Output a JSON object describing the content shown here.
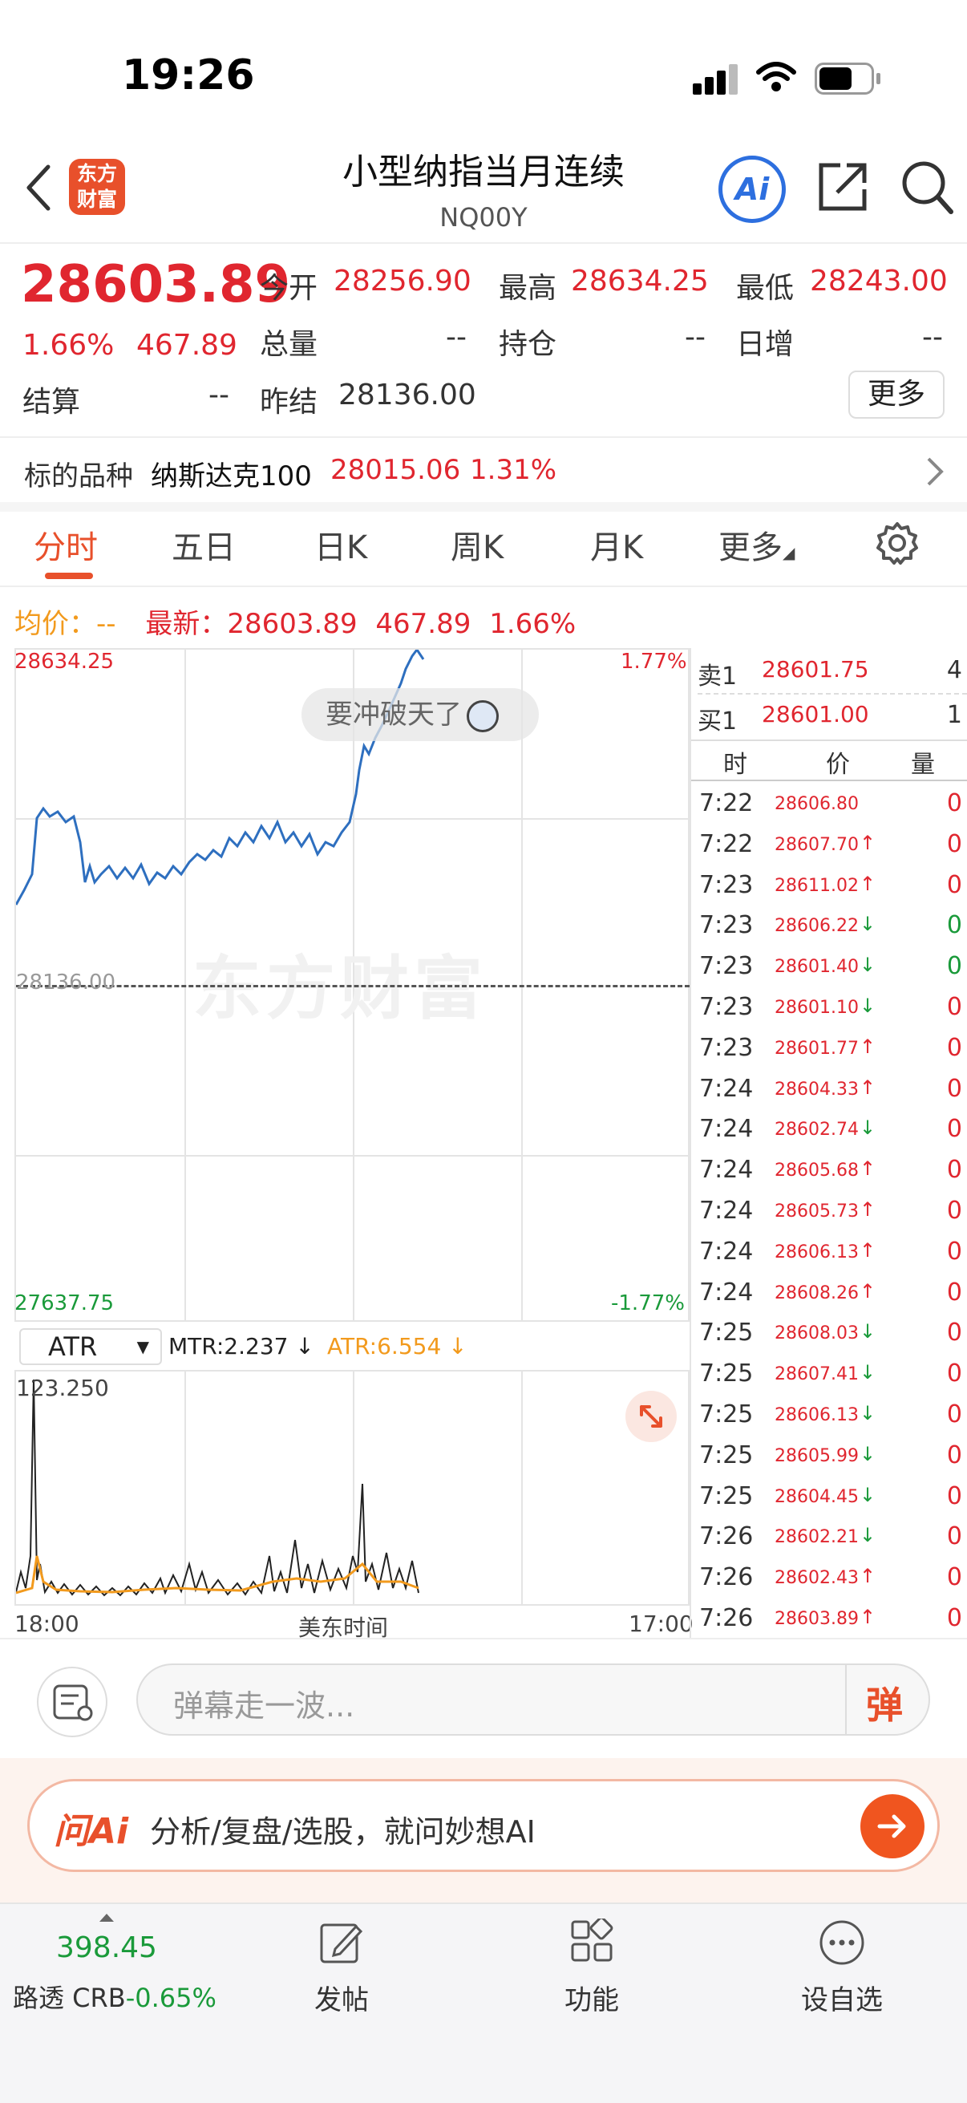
{
  "status_bar": {
    "time": "19:26"
  },
  "header": {
    "title": "小型纳指当月连续",
    "code": "NQ00Y",
    "logo_line1": "东方",
    "logo_line2": "财富",
    "ai_label": "Ai"
  },
  "quote": {
    "price": "28603.89",
    "change_pct": "1.66%",
    "change": "467.89",
    "open_label": "今开",
    "open": "28256.90",
    "high_label": "最高",
    "high": "28634.25",
    "low_label": "最低",
    "low": "28243.00",
    "volume_label": "总量",
    "volume": "--",
    "position_label": "持仓",
    "position": "--",
    "daily_inc_label": "日增",
    "daily_inc": "--",
    "settle_label": "结算",
    "settle": "--",
    "prev_settle_label": "昨结",
    "prev_settle": "28136.00",
    "more_label": "更多"
  },
  "underlying": {
    "label": "标的品种",
    "name": "纳斯达克100",
    "price": "28015.06",
    "pct": "1.31%"
  },
  "tabs": [
    "分时",
    "五日",
    "日K",
    "周K",
    "月K",
    "更多"
  ],
  "chart": {
    "avg_label": "均价：",
    "avg_value": "--",
    "latest_label": "最新：",
    "latest": "28603.89",
    "latest_change": "467.89",
    "latest_pct": "1.66%",
    "y_max": "28634.25",
    "y_min": "27637.75",
    "pct_max": "1.77%",
    "pct_min": "-1.77%",
    "base_label": "28136.00",
    "bubble_text": "要冲破天了",
    "watermark": "东方财富",
    "x_start": "18:00",
    "x_mid": "美东时间",
    "x_end": "17:00"
  },
  "indicator": {
    "name": "ATR",
    "mtr": "MTR:2.237 ↓",
    "atr": "ATR:6.554 ↓",
    "y_max": "123.250"
  },
  "order_book": {
    "sell_label": "卖1",
    "sell_price": "28601.75",
    "sell_vol": "4",
    "buy_label": "买1",
    "buy_price": "28601.00",
    "buy_vol": "1",
    "col_time": "时",
    "col_price": "价",
    "col_vol": "量"
  },
  "trades": [
    {
      "time": "7:22",
      "price": "28606.80",
      "dir": "",
      "vol": "0",
      "vol_color": "red"
    },
    {
      "time": "7:22",
      "price": "28607.70",
      "dir": "up",
      "vol": "0",
      "vol_color": "red"
    },
    {
      "time": "7:23",
      "price": "28611.02",
      "dir": "up",
      "vol": "0",
      "vol_color": "red"
    },
    {
      "time": "7:23",
      "price": "28606.22",
      "dir": "down",
      "vol": "0",
      "vol_color": "green"
    },
    {
      "time": "7:23",
      "price": "28601.40",
      "dir": "down",
      "vol": "0",
      "vol_color": "green"
    },
    {
      "time": "7:23",
      "price": "28601.10",
      "dir": "down",
      "vol": "0",
      "vol_color": "red"
    },
    {
      "time": "7:23",
      "price": "28601.77",
      "dir": "up",
      "vol": "0",
      "vol_color": "red"
    },
    {
      "time": "7:24",
      "price": "28604.33",
      "dir": "up",
      "vol": "0",
      "vol_color": "red"
    },
    {
      "time": "7:24",
      "price": "28602.74",
      "dir": "down",
      "vol": "0",
      "vol_color": "red"
    },
    {
      "time": "7:24",
      "price": "28605.68",
      "dir": "up",
      "vol": "0",
      "vol_color": "red"
    },
    {
      "time": "7:24",
      "price": "28605.73",
      "dir": "up",
      "vol": "0",
      "vol_color": "red"
    },
    {
      "time": "7:24",
      "price": "28606.13",
      "dir": "up",
      "vol": "0",
      "vol_color": "red"
    },
    {
      "time": "7:24",
      "price": "28608.26",
      "dir": "up",
      "vol": "0",
      "vol_color": "red"
    },
    {
      "time": "7:25",
      "price": "28608.03",
      "dir": "down",
      "vol": "0",
      "vol_color": "red"
    },
    {
      "time": "7:25",
      "price": "28607.41",
      "dir": "down",
      "vol": "0",
      "vol_color": "red"
    },
    {
      "time": "7:25",
      "price": "28606.13",
      "dir": "down",
      "vol": "0",
      "vol_color": "red"
    },
    {
      "time": "7:25",
      "price": "28605.99",
      "dir": "down",
      "vol": "0",
      "vol_color": "red"
    },
    {
      "time": "7:25",
      "price": "28604.45",
      "dir": "down",
      "vol": "0",
      "vol_color": "red"
    },
    {
      "time": "7:26",
      "price": "28602.21",
      "dir": "down",
      "vol": "0",
      "vol_color": "red"
    },
    {
      "time": "7:26",
      "price": "28602.43",
      "dir": "up",
      "vol": "0",
      "vol_color": "red"
    },
    {
      "time": "7:26",
      "price": "28603.89",
      "dir": "up",
      "vol": "0",
      "vol_color": "red"
    }
  ],
  "comment": {
    "placeholder": "弹幕走一波...",
    "danmu_label": "弹"
  },
  "ai_bar": {
    "brand": "问Ai",
    "prompt": "分析/复盘/选股，就问妙想AI"
  },
  "bottom_nav": {
    "ticker_value": "398.45",
    "ticker_name": "路透 CRB",
    "ticker_pct": "-0.65%",
    "items": [
      "发帖",
      "功能",
      "设自选"
    ]
  },
  "colors": {
    "up": "#e0262f",
    "down": "#1a9a3a",
    "accent": "#e8502b",
    "price_line": "#2e6fbf",
    "atr_line": "#f29a1d"
  }
}
